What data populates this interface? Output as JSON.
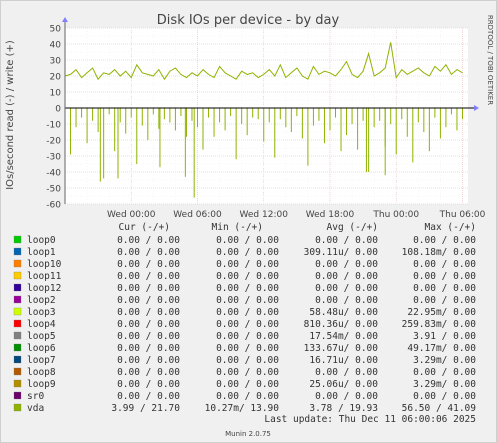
{
  "brand": {
    "side_credit": "RRDTOOL / TOBI OETIKER",
    "footer": "Munin 2.0.75"
  },
  "legend": {
    "col_cur": "Cur (-/+)",
    "col_min": "Min (-/+)",
    "col_avg": "Avg (-/+)",
    "col_max": "Max (-/+)",
    "rows": [
      {
        "name": "loop0",
        "color": "#00cc00",
        "cur": "0.00 /  0.00",
        "min": "0.00 /  0.00",
        "avg": "0.00 /  0.00",
        "max": "0.00 /  0.00"
      },
      {
        "name": "loop1",
        "color": "#0066b3",
        "cur": "0.00 /  0.00",
        "min": "0.00 /  0.00",
        "avg": "309.11u/  0.00",
        "max": "108.18m/  0.00"
      },
      {
        "name": "loop10",
        "color": "#ff8000",
        "cur": "0.00 /  0.00",
        "min": "0.00 /  0.00",
        "avg": "0.00 /  0.00",
        "max": "0.00 /  0.00"
      },
      {
        "name": "loop11",
        "color": "#ffcc00",
        "cur": "0.00 /  0.00",
        "min": "0.00 /  0.00",
        "avg": "0.00 /  0.00",
        "max": "0.00 /  0.00"
      },
      {
        "name": "loop12",
        "color": "#330099",
        "cur": "0.00 /  0.00",
        "min": "0.00 /  0.00",
        "avg": "0.00 /  0.00",
        "max": "0.00 /  0.00"
      },
      {
        "name": "loop2",
        "color": "#990099",
        "cur": "0.00 /  0.00",
        "min": "0.00 /  0.00",
        "avg": "0.00 /  0.00",
        "max": "0.00 /  0.00"
      },
      {
        "name": "loop3",
        "color": "#ccff00",
        "cur": "0.00 /  0.00",
        "min": "0.00 /  0.00",
        "avg": "58.48u/  0.00",
        "max": "22.95m/  0.00"
      },
      {
        "name": "loop4",
        "color": "#ff0000",
        "cur": "0.00 /  0.00",
        "min": "0.00 /  0.00",
        "avg": "810.36u/  0.00",
        "max": "259.83m/  0.00"
      },
      {
        "name": "loop5",
        "color": "#808080",
        "cur": "0.00 /  0.00",
        "min": "0.00 /  0.00",
        "avg": "17.54m/  0.00",
        "max": "3.91 /  0.00"
      },
      {
        "name": "loop6",
        "color": "#008f00",
        "cur": "0.00 /  0.00",
        "min": "0.00 /  0.00",
        "avg": "133.67u/  0.00",
        "max": "49.17m/  0.00"
      },
      {
        "name": "loop7",
        "color": "#00487d",
        "cur": "0.00 /  0.00",
        "min": "0.00 /  0.00",
        "avg": "16.71u/  0.00",
        "max": "3.29m/  0.00"
      },
      {
        "name": "loop8",
        "color": "#b35a00",
        "cur": "0.00 /  0.00",
        "min": "0.00 /  0.00",
        "avg": "0.00 /  0.00",
        "max": "0.00 /  0.00"
      },
      {
        "name": "loop9",
        "color": "#b38f00",
        "cur": "0.00 /  0.00",
        "min": "0.00 /  0.00",
        "avg": "25.06u/  0.00",
        "max": "3.29m/  0.00"
      },
      {
        "name": "sr0",
        "color": "#6b006b",
        "cur": "0.00 /  0.00",
        "min": "0.00 /  0.00",
        "avg": "0.00 /  0.00",
        "max": "0.00 /  0.00"
      },
      {
        "name": "vda",
        "color": "#8fb300",
        "cur": "3.99 / 21.70",
        "min": "10.27m/ 13.90",
        "avg": "3.78 / 19.93",
        "max": "56.50 / 41.09"
      }
    ],
    "last_update": "Last update: Thu Dec 11 06:00:06 2025"
  },
  "chart_data": {
    "type": "line",
    "title": "Disk IOs per device - by day",
    "ylabel": "IOs/second read (-) / write (+)",
    "xlabel": "",
    "ylim": [
      -60,
      50
    ],
    "yticks": [
      50,
      40,
      30,
      20,
      10,
      0,
      -10,
      -20,
      -30,
      -40,
      -50,
      -60
    ],
    "xticks": [
      "Wed 00:00",
      "Wed 06:00",
      "Wed 12:00",
      "Wed 18:00",
      "Thu 00:00",
      "Thu 06:00"
    ],
    "xticks_hours": [
      6,
      12,
      18,
      24,
      30,
      36
    ],
    "x_range_hours": [
      0,
      36.5
    ],
    "grid": true,
    "series": [
      {
        "name": "vda",
        "color": "#8fb300",
        "x_hours": [
          0,
          0.5,
          1,
          1.5,
          2,
          2.5,
          3,
          3.5,
          4,
          4.5,
          5,
          5.5,
          6,
          6.5,
          7,
          7.5,
          8,
          8.5,
          9,
          9.5,
          10,
          10.5,
          11,
          11.5,
          12,
          12.5,
          13,
          13.5,
          14,
          14.5,
          15,
          15.5,
          16,
          16.5,
          17,
          17.5,
          18,
          18.5,
          19,
          19.5,
          20,
          20.5,
          21,
          21.5,
          22,
          22.5,
          23,
          23.5,
          24,
          24.5,
          25,
          25.5,
          26,
          26.5,
          27,
          27.5,
          28,
          28.5,
          29,
          29.5,
          30,
          30.5,
          31,
          31.5,
          32,
          32.5,
          33,
          33.5,
          34,
          34.5,
          35,
          35.5,
          36
        ],
        "write": [
          20,
          21,
          24,
          19,
          22,
          25,
          18,
          22,
          21,
          24,
          20,
          23,
          19,
          27,
          22,
          21,
          20,
          24,
          18,
          23,
          25,
          21,
          19,
          22,
          20,
          24,
          21,
          19,
          26,
          22,
          20,
          18,
          23,
          21,
          22,
          19,
          21,
          24,
          20,
          27,
          19,
          22,
          25,
          20,
          18,
          26,
          21,
          23,
          22,
          20,
          24,
          29,
          21,
          19,
          23,
          34,
          20,
          22,
          25,
          41,
          19,
          24,
          21,
          23,
          25,
          22,
          20,
          26,
          23,
          27,
          21,
          24,
          22
        ],
        "read": [
          -18,
          -29,
          -12,
          -6,
          -22,
          -8,
          -15,
          -44,
          -4,
          -27,
          -9,
          -16,
          -6,
          -35,
          -11,
          -20,
          -4,
          -13,
          -7,
          -9,
          -14,
          -5,
          -18,
          -8,
          -12,
          -26,
          -6,
          -18,
          -9,
          -14,
          -5,
          -32,
          -10,
          -17,
          -6,
          -7,
          -21,
          -9,
          -31,
          -7,
          -12,
          -15,
          -5,
          -19,
          -36,
          -11,
          -8,
          -22,
          -14,
          -6,
          -27,
          -17,
          -10,
          -26,
          -8,
          -40,
          -12,
          -8,
          -24,
          -10,
          -29,
          -7,
          -18,
          -34,
          -9,
          -15,
          -27,
          -6,
          -19,
          -12,
          -4,
          -14,
          -7
        ],
        "read_spikes": [
          [
            3.2,
            -46
          ],
          [
            4.8,
            -44
          ],
          [
            8.6,
            -37
          ],
          [
            11.7,
            -56
          ],
          [
            10.9,
            -43
          ],
          [
            29.0,
            -42
          ],
          [
            27.3,
            -40
          ]
        ]
      }
    ]
  }
}
